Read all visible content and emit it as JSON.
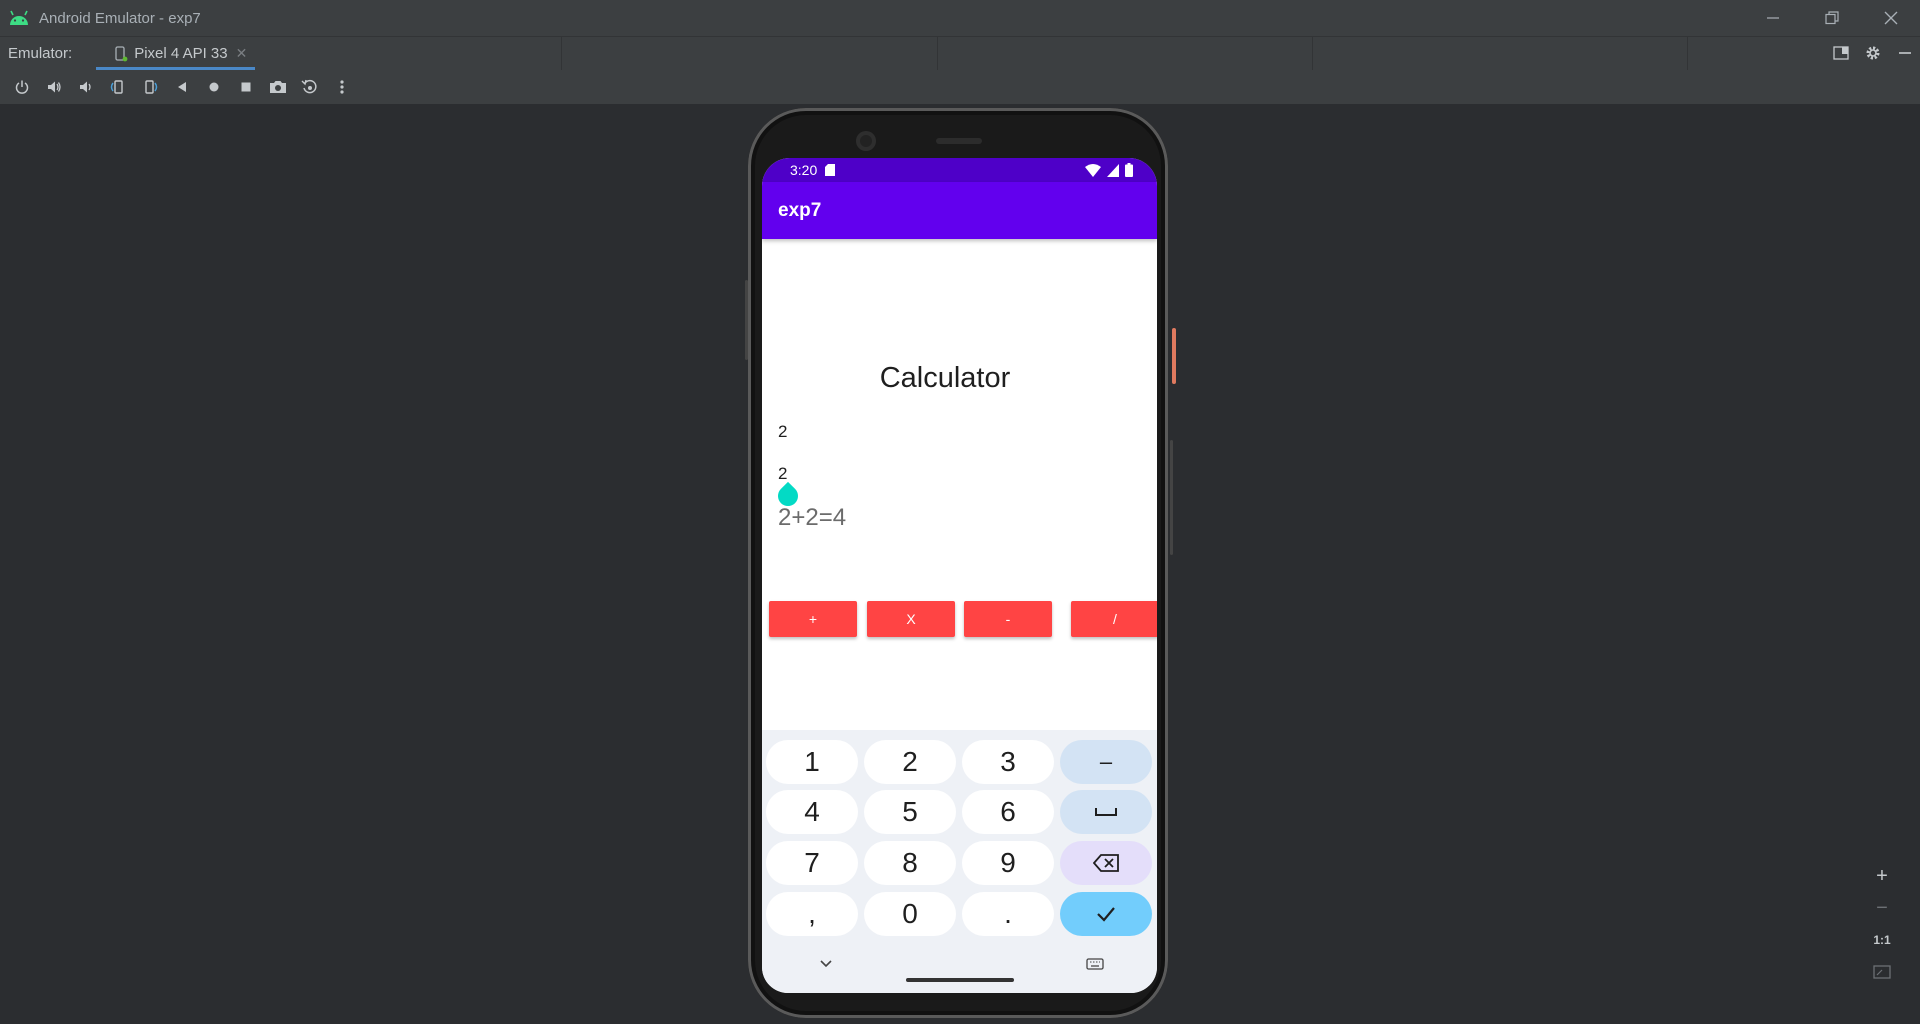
{
  "window": {
    "title": "Android Emulator - exp7",
    "controls": [
      "minimize-icon",
      "restore-icon",
      "close-icon"
    ]
  },
  "tabbar": {
    "label": "Emulator:",
    "device_tab": "Pixel 4 API 33"
  },
  "toolbar": {
    "icons": [
      "power-icon",
      "volume-up-icon",
      "volume-down-icon",
      "rotate-left-icon",
      "rotate-right-icon",
      "back-icon",
      "home-icon",
      "overview-icon",
      "screenshot-icon",
      "snapshot-icon",
      "more-icon"
    ]
  },
  "zoom": {
    "plus": "+",
    "minus": "−",
    "one_to_one": "1:1"
  },
  "phone": {
    "status": {
      "time": "3:20"
    },
    "app_title": "exp7",
    "heading": "Calculator",
    "input1": "2",
    "input2": "2",
    "result": "2+2=4",
    "buttons": {
      "add": "+",
      "multiply": "X",
      "subtract": "-",
      "divide": "/"
    },
    "keyboard": {
      "row1": [
        "1",
        "2",
        "3"
      ],
      "row2": [
        "4",
        "5",
        "6"
      ],
      "row3": [
        "7",
        "8",
        "9"
      ],
      "row4": [
        ",",
        "0",
        "."
      ],
      "minus_key": "–"
    }
  },
  "colors": {
    "status_bar": "#4e00c8",
    "app_bar": "#6200ee",
    "op_button": "#ff4444",
    "cursor_handle": "#03dac5",
    "done_key": "#72cdfc"
  }
}
